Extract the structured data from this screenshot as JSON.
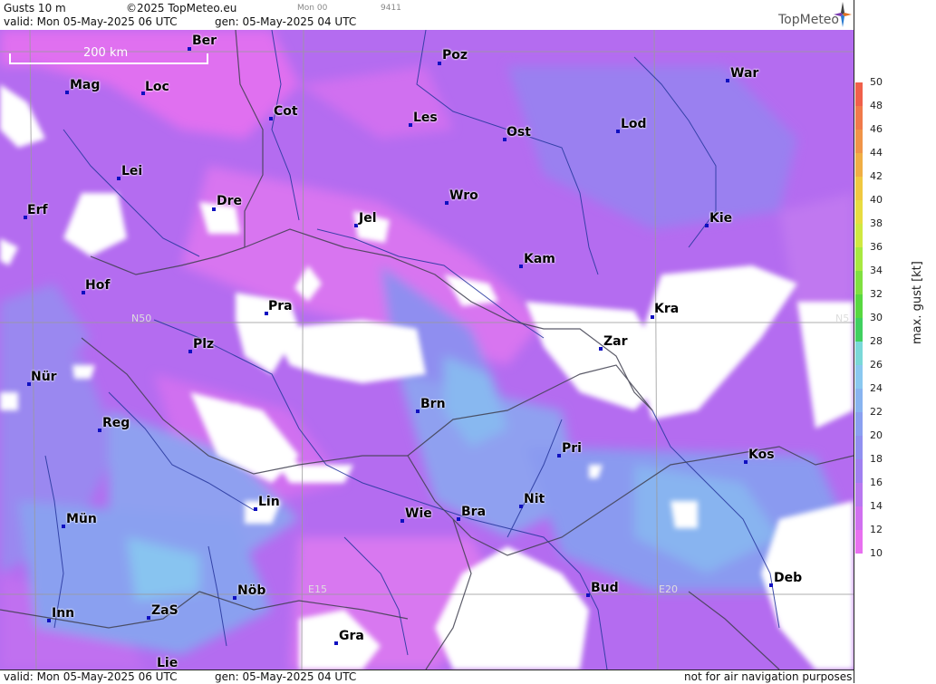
{
  "header": {
    "product": "Gusts 10 m",
    "copyright": "©2025 TopMeteo.eu",
    "valid": "valid:  Mon  05-May-2025  06 UTC",
    "gen": "gen: 05-May-2025 04 UTC",
    "run_small": "Mon 00",
    "code_small": "9411",
    "brand": "TopMeteo"
  },
  "footer": {
    "valid": "valid:  Mon  05-May-2025  06 UTC",
    "gen": "gen: 05-May-2025 04 UTC",
    "notice": "not for air navigation purposes"
  },
  "scale_bar": "200 km",
  "grid_labels": {
    "lat": "N50",
    "lat_right": "N5",
    "lon1": "E15",
    "lon2": "E20"
  },
  "cities": [
    {
      "name": "Ber"
    },
    {
      "name": "Poz"
    },
    {
      "name": "War"
    },
    {
      "name": "Mag"
    },
    {
      "name": "Loc"
    },
    {
      "name": "Cot"
    },
    {
      "name": "Les"
    },
    {
      "name": "Ost"
    },
    {
      "name": "Lod"
    },
    {
      "name": "Lei"
    },
    {
      "name": "Erf"
    },
    {
      "name": "Dre"
    },
    {
      "name": "Jel"
    },
    {
      "name": "Wro"
    },
    {
      "name": "Kie"
    },
    {
      "name": "Kam"
    },
    {
      "name": "Hof"
    },
    {
      "name": "Pra"
    },
    {
      "name": "Kra"
    },
    {
      "name": "Zar"
    },
    {
      "name": "Plz"
    },
    {
      "name": "Nür"
    },
    {
      "name": "Brn"
    },
    {
      "name": "Reg"
    },
    {
      "name": "Pri"
    },
    {
      "name": "Kos"
    },
    {
      "name": "Lin"
    },
    {
      "name": "Nit"
    },
    {
      "name": "Wie"
    },
    {
      "name": "Bra"
    },
    {
      "name": "Mün"
    },
    {
      "name": "Bud"
    },
    {
      "name": "Deb"
    },
    {
      "name": "Nöb"
    },
    {
      "name": "ZaS"
    },
    {
      "name": "Inn"
    },
    {
      "name": "Gra"
    },
    {
      "name": "Lie"
    }
  ],
  "colorbar": {
    "title": "max. gust [kt]",
    "ticks": [
      "50",
      "48",
      "46",
      "44",
      "42",
      "40",
      "38",
      "36",
      "34",
      "32",
      "30",
      "28",
      "26",
      "24",
      "22",
      "20",
      "18",
      "16",
      "14",
      "12",
      "10"
    ],
    "colors": [
      "#f0604a",
      "#f07a4a",
      "#f09448",
      "#f0ae44",
      "#f0c840",
      "#e8dc40",
      "#d0e840",
      "#a8e840",
      "#80e040",
      "#58d840",
      "#40d060",
      "#7ad8d8",
      "#8ac8f0",
      "#88b4f0",
      "#8aa0f0",
      "#9090f0",
      "#a080f0",
      "#b878f0",
      "#d070f0",
      "#e870f0",
      "#ffffff"
    ]
  }
}
